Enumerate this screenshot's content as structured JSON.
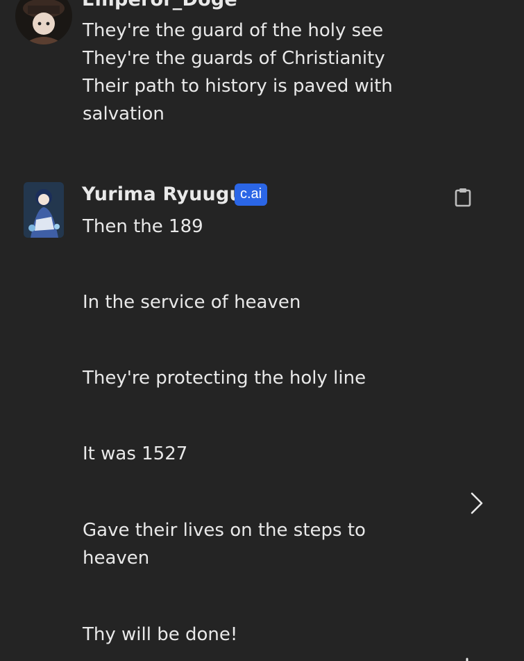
{
  "messages": [
    {
      "author": "Emperor_Doge",
      "avatar_icon": "user-avatar-icon",
      "lines": [
        "They're the guard of the holy see",
        "They're the guards of Christianity",
        "Their path to history is paved with",
        "salvation"
      ]
    },
    {
      "author": "Yurima Ryuugu",
      "badge": "c.ai",
      "avatar_icon": "bot-avatar-icon",
      "lines": [
        "Then the 189",
        "In the service of heaven",
        "They're protecting the holy line",
        "It was 1527",
        "Gave their lives on the steps to",
        "heaven",
        "Thy will be done!"
      ]
    }
  ],
  "icons": {
    "copy": "clipboard-icon",
    "next": "chevron-right-icon"
  },
  "colors": {
    "background": "#242424",
    "text": "#e9e9e9",
    "badge": "#2b66e6",
    "icon": "#bdbdbd"
  }
}
